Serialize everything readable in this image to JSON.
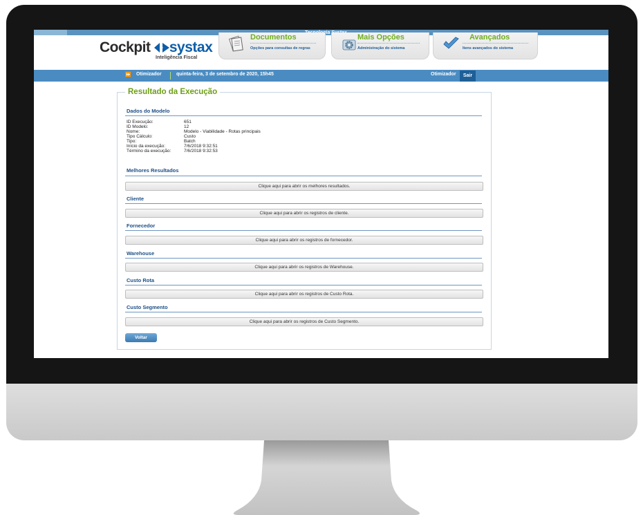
{
  "header": {
    "tagline": "Tecnologia Systax",
    "logo": {
      "part1": "Cockpit",
      "part2": "systax",
      "subtitle": "Inteligência Fiscal"
    },
    "nav": [
      {
        "title": "Documentos",
        "desc": "Opções para consultas de regras",
        "icon": "documents-icon"
      },
      {
        "title": "Mais Opções",
        "desc": "Administração do sistema",
        "icon": "settings-gear-icon"
      },
      {
        "title": "Avançados",
        "desc": "Itens avançados do sistema",
        "icon": "advanced-check-icon"
      }
    ],
    "breadcrumb_icon": "double-chevron-right-icon",
    "breadcrumb": "Otimizador",
    "date": "quinta-feira, 3 de setembro de 2020, 15h45",
    "user": "Otimizador",
    "logout": "Sair"
  },
  "page": {
    "title": "Resultado da Execução",
    "model_section": {
      "heading": "Dados do Modelo",
      "fields": [
        {
          "label": "ID Execução:",
          "value": "651"
        },
        {
          "label": "ID Modelo:",
          "value": "12"
        },
        {
          "label": "Nome:",
          "value": "Modelo - Viabilidade - Rotas principais"
        },
        {
          "label": "Tipo Cálculo:",
          "value": "Custo"
        },
        {
          "label": "Tipo:",
          "value": "Batch"
        },
        {
          "label": "Início da execução:",
          "value": "7/6/2018 9:32:51"
        },
        {
          "label": "Término da execução:",
          "value": "7/6/2018 9:32:53"
        }
      ]
    },
    "sections": [
      {
        "heading": "Melhores Resultados",
        "button": "Clique aqui para abrir os melhores resultados."
      },
      {
        "heading": "Cliente",
        "button": "Clique aqui para abrir os registros de cliente."
      },
      {
        "heading": "Fornecedor",
        "button": "Clique aqui para abrir os registros de fornecedor."
      },
      {
        "heading": "Warehouse",
        "button": "Clique aqui para abrir os registros de Warehouse."
      },
      {
        "heading": "Custo Rota",
        "button": "Clique aqui para abrir os registros de Custo Rota."
      },
      {
        "heading": "Custo Segmento",
        "button": "Clique aqui para abrir os registros de Custo Segmento."
      }
    ],
    "back_button": "Voltar"
  }
}
